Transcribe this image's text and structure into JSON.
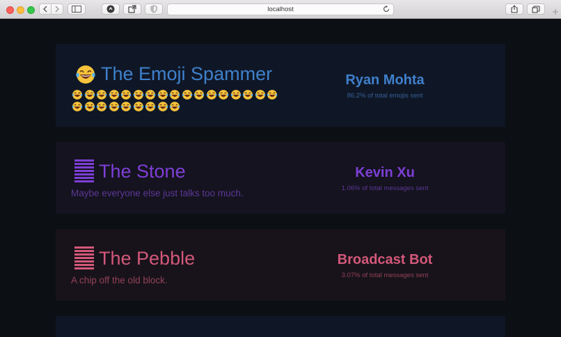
{
  "browser": {
    "url": "localhost"
  },
  "cards": [
    {
      "title": "The Emoji Spammer",
      "icon": "laughing-tears-emoji-icon",
      "emoji_row_1_count": 17,
      "emoji_row_2_count": 9,
      "winner": "Ryan Mohta",
      "stat": "86.2% of total emojis sent",
      "color": "#3f80cc"
    },
    {
      "title": "The Stone",
      "icon": "stacked-bars-icon",
      "subtitle": "Maybe everyone else just talks too much.",
      "winner": "Kevin Xu",
      "stat": "1.06% of total messages sent",
      "color": "#7d3fd6"
    },
    {
      "title": "The Pebble",
      "icon": "stacked-bars-icon",
      "subtitle": "A chip off the old block.",
      "winner": "Broadcast Bot",
      "stat": "3.07% of total messages sent",
      "color": "#d3587a"
    }
  ]
}
